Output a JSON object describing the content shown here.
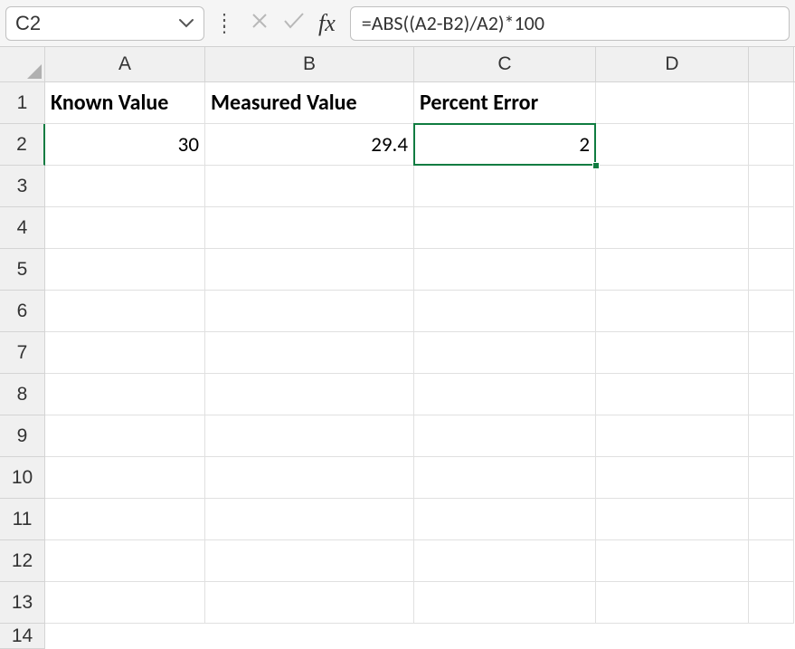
{
  "nameBox": {
    "value": "C2"
  },
  "formulaBar": {
    "fxLabel": "fx",
    "formula": "=ABS((A2-B2)/A2)*100"
  },
  "columns": {
    "a": "A",
    "b": "B",
    "c": "C",
    "d": "D"
  },
  "rows": {
    "r1": "1",
    "r2": "2",
    "r3": "3",
    "r4": "4",
    "r5": "5",
    "r6": "6",
    "r7": "7",
    "r8": "8",
    "r9": "9",
    "r10": "10",
    "r11": "11",
    "r12": "12",
    "r13": "13",
    "r14": "14"
  },
  "cells": {
    "A1": "Known Value",
    "B1": "Measured Value",
    "C1": "Percent Error",
    "A2": "30",
    "B2": "29.4",
    "C2": "2"
  },
  "selection": {
    "cell": "C2"
  }
}
